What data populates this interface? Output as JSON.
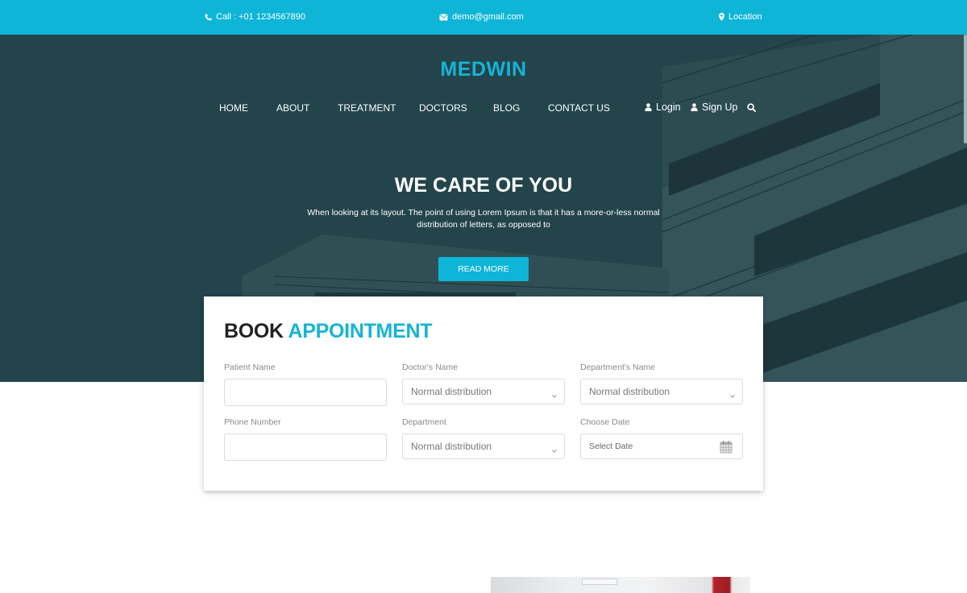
{
  "topbar": {
    "call": "Call : +01 1234567890",
    "email": "demo@gmail.com",
    "location": "Location",
    "background": "#0eb5d6"
  },
  "brand": {
    "logo": "MEDWIN",
    "accent": "#17b3d6"
  },
  "nav": {
    "items": [
      "HOME",
      "ABOUT",
      "TREATMENT",
      "DOCTORS",
      "BLOG",
      "CONTACT US"
    ],
    "login": "Login",
    "signup": "Sign Up",
    "search_icon": "search-icon"
  },
  "hero": {
    "title": "WE CARE OF YOU",
    "text": "When looking at its layout. The point of using Lorem Ipsum is that it has a more-or-less normal distribution of letters, as opposed to",
    "button": "READ MORE",
    "overlay_color": "#23444b"
  },
  "appointment": {
    "title_dark": "BOOK",
    "title_accent": "APPOINTMENT",
    "fields": [
      {
        "label": "Patient Name",
        "type": "text",
        "value": ""
      },
      {
        "label": "Doctor's Name",
        "type": "select",
        "value": "Normal distribution"
      },
      {
        "label": "Department's Name",
        "type": "select",
        "value": "Normal distribution"
      },
      {
        "label": "Phone Number",
        "type": "text",
        "value": ""
      },
      {
        "label": "Department",
        "type": "select",
        "value": "Normal distribution"
      },
      {
        "label": "Choose Date",
        "type": "date",
        "placeholder": "Select Date"
      }
    ]
  }
}
